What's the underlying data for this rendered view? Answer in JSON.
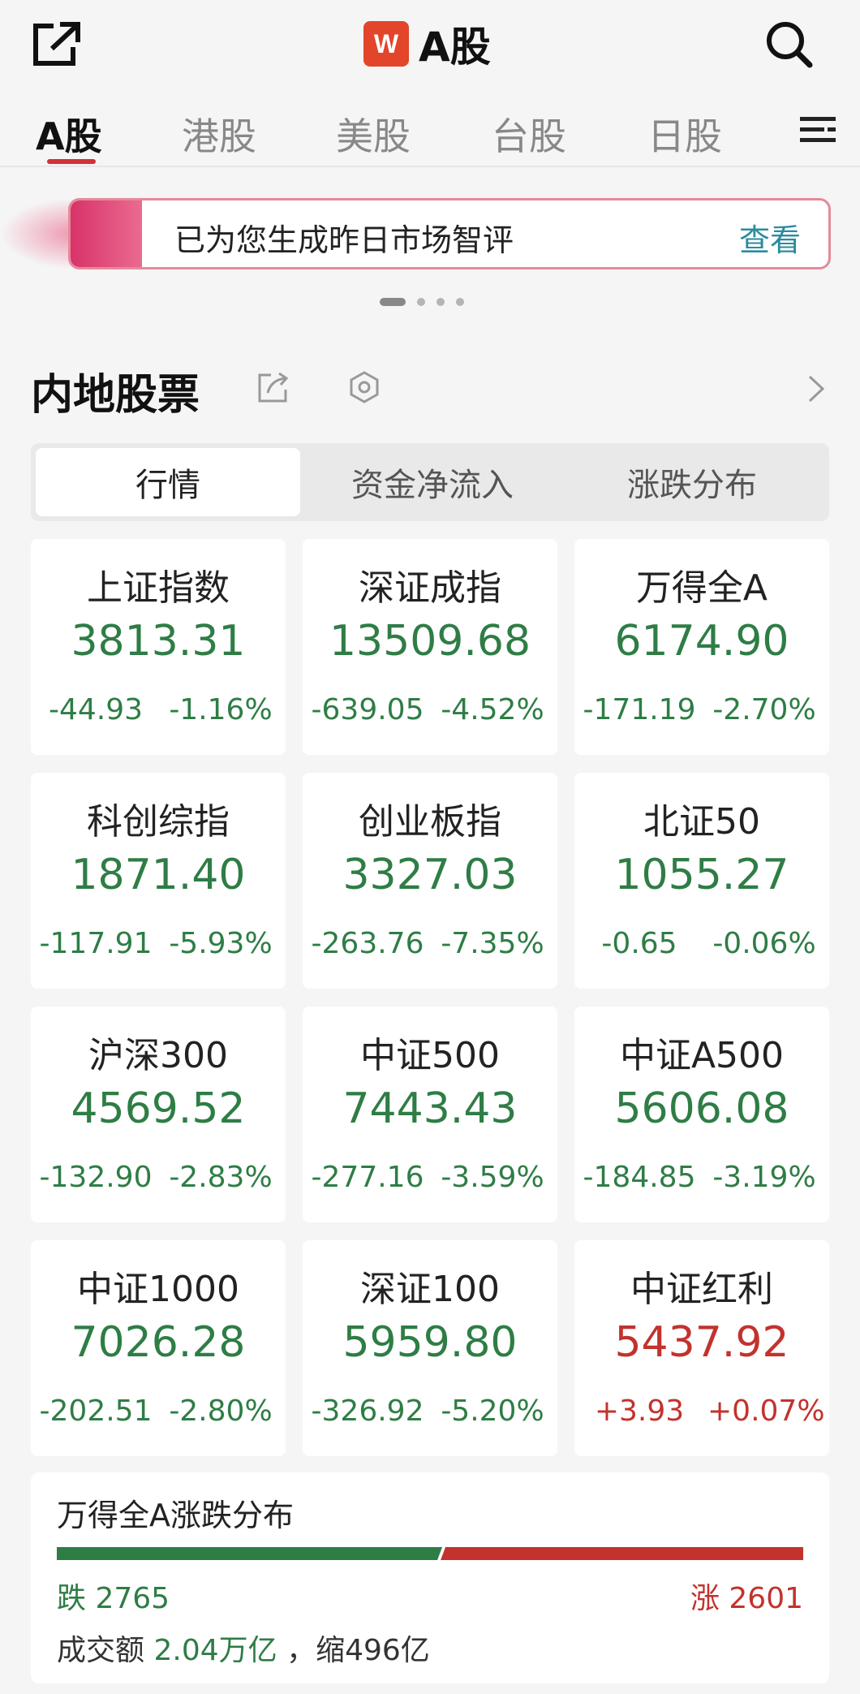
{
  "header": {
    "logo_letter": "W",
    "title": "A股"
  },
  "market_tabs": [
    "A股",
    "港股",
    "美股",
    "台股",
    "日股"
  ],
  "banner": {
    "text": "已为您生成昨日市场智评",
    "link": "查看"
  },
  "section": {
    "title": "内地股票"
  },
  "segments": [
    "行情",
    "资金净流入",
    "涨跌分布"
  ],
  "indices": [
    {
      "name": "上证指数",
      "value": "3813.31",
      "change": "-44.93",
      "pct": "-1.16%",
      "dir": "down"
    },
    {
      "name": "深证成指",
      "value": "13509.68",
      "change": "-639.05",
      "pct": "-4.52%",
      "dir": "down"
    },
    {
      "name": "万得全A",
      "value": "6174.90",
      "change": "-171.19",
      "pct": "-2.70%",
      "dir": "down"
    },
    {
      "name": "科创综指",
      "value": "1871.40",
      "change": "-117.91",
      "pct": "-5.93%",
      "dir": "down"
    },
    {
      "name": "创业板指",
      "value": "3327.03",
      "change": "-263.76",
      "pct": "-7.35%",
      "dir": "down"
    },
    {
      "name": "北证50",
      "value": "1055.27",
      "change": "-0.65",
      "pct": "-0.06%",
      "dir": "down"
    },
    {
      "name": "沪深300",
      "value": "4569.52",
      "change": "-132.90",
      "pct": "-2.83%",
      "dir": "down"
    },
    {
      "name": "中证500",
      "value": "7443.43",
      "change": "-277.16",
      "pct": "-3.59%",
      "dir": "down"
    },
    {
      "name": "中证A500",
      "value": "5606.08",
      "change": "-184.85",
      "pct": "-3.19%",
      "dir": "down"
    },
    {
      "name": "中证1000",
      "value": "7026.28",
      "change": "-202.51",
      "pct": "-2.80%",
      "dir": "down"
    },
    {
      "name": "深证100",
      "value": "5959.80",
      "change": "-326.92",
      "pct": "-5.20%",
      "dir": "down"
    },
    {
      "name": "中证红利",
      "value": "5437.92",
      "change": "+3.93",
      "pct": "+0.07%",
      "dir": "up"
    }
  ],
  "distribution": {
    "title": "万得全A涨跌分布",
    "down_label": "跌 2765",
    "up_label": "涨 2601",
    "down_count": 2765,
    "up_count": 2601,
    "volume_prefix": "成交额",
    "volume_value": "2.04万亿",
    "volume_suffix": "，缩496亿"
  },
  "colors": {
    "down": "#2e7d45",
    "up": "#c3322d",
    "accent": "#d0323a",
    "link": "#2a8c9e"
  }
}
